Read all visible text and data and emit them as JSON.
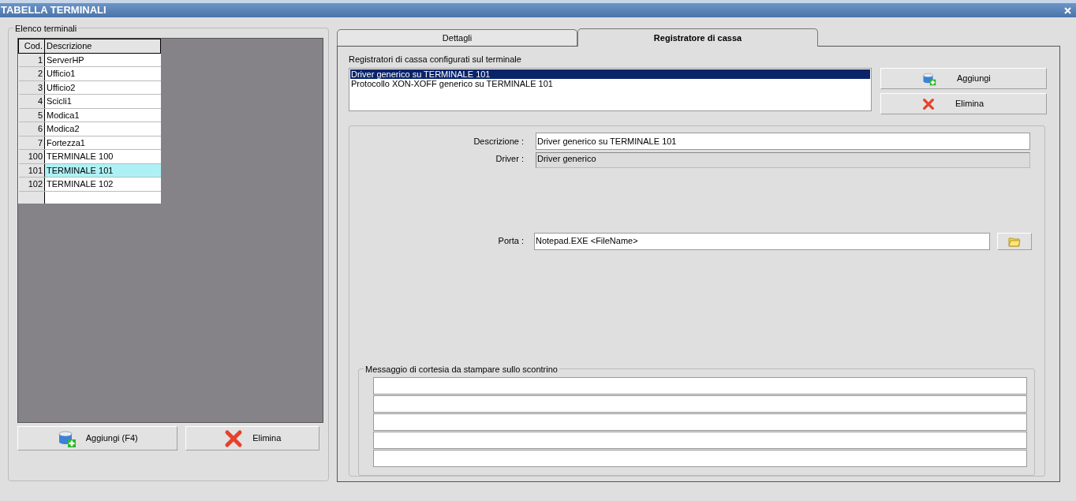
{
  "window": {
    "title": "TABELLA TERMINALI"
  },
  "terminals": {
    "title": "Elenco terminali",
    "columns": [
      "Cod.",
      "Descrizione"
    ],
    "rows": [
      {
        "code": "1",
        "description": "ServerHP",
        "selected": false
      },
      {
        "code": "2",
        "description": "Ufficio1",
        "selected": false
      },
      {
        "code": "3",
        "description": "Ufficio2",
        "selected": false
      },
      {
        "code": "4",
        "description": "Scicli1",
        "selected": false
      },
      {
        "code": "5",
        "description": "Modica1",
        "selected": false
      },
      {
        "code": "6",
        "description": "Modica2",
        "selected": false
      },
      {
        "code": "7",
        "description": "Fortezza1",
        "selected": false
      },
      {
        "code": "100",
        "description": "TERMINALE 100",
        "selected": false
      },
      {
        "code": "101",
        "description": "TERMINALE 101",
        "selected": true
      },
      {
        "code": "102",
        "description": "TERMINALE 102",
        "selected": false
      }
    ],
    "buttons": [
      {
        "label": "Aggiungi (F4)",
        "kind": "add"
      },
      {
        "label": "Elimina",
        "kind": "delete"
      }
    ]
  },
  "tabs": [
    {
      "label": "Dettagli",
      "selected": false
    },
    {
      "label": "Registratore di cassa",
      "selected": true
    }
  ],
  "registers": {
    "label": "Registratori di cassa configurati sul terminale",
    "items": [
      {
        "text": "Driver generico su TERMINALE 101",
        "selected": true
      },
      {
        "text": "Protocollo XON-XOFF generico su TERMINALE 101",
        "selected": false
      }
    ],
    "buttons": [
      {
        "label": "Aggiungi",
        "kind": "add"
      },
      {
        "label": "Elimina",
        "kind": "delete"
      }
    ]
  },
  "form": {
    "fields": [
      {
        "label": "Descrizione :",
        "value": "Driver generico su TERMINALE 101",
        "kind": "input"
      },
      {
        "label": "Driver :",
        "value": "Driver generico",
        "kind": "readonly"
      },
      {
        "label": "Porta :",
        "value": "Notepad.EXE <FileName>",
        "kind": "browse"
      }
    ]
  },
  "message": {
    "title": "Messaggio di cortesia da stampare sullo scontrino",
    "lines": [
      {
        "kind": "input"
      },
      {
        "kind": "input"
      },
      {
        "kind": "input"
      },
      {
        "kind": "input"
      },
      {
        "kind": "input"
      }
    ]
  }
}
